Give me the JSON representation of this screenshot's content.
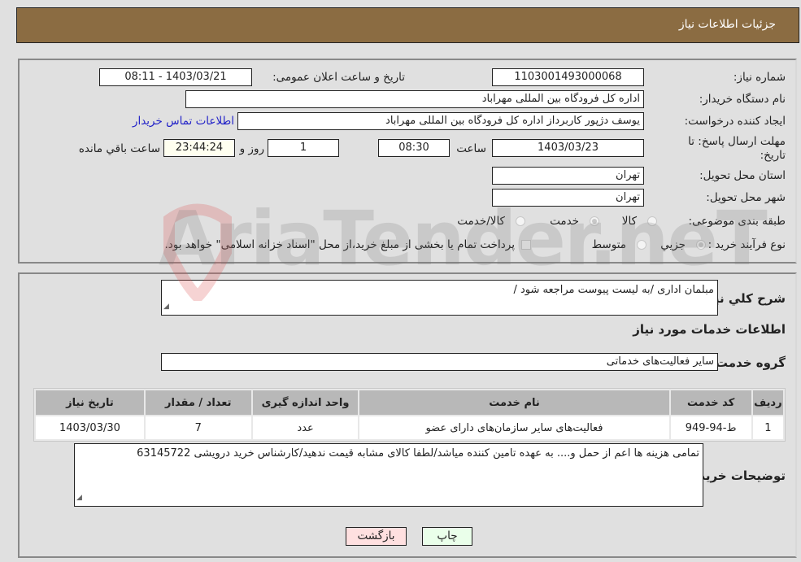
{
  "header": {
    "title": "جزئیات اطلاعات نیاز"
  },
  "form": {
    "need_number_label": "شماره نیاز:",
    "need_number": "1103001493000068",
    "announce_label": "تاریخ و ساعت اعلان عمومی:",
    "announce_value": "1403/03/21 - 08:11",
    "buyer_org_label": "نام دستگاه خریدار:",
    "buyer_org": "اداره کل فرودگاه بین المللی مهراباد",
    "creator_label": "ایجاد کننده درخواست:",
    "creator": "یوسف دژپور کاربرداز اداره کل فرودگاه بین المللی مهراباد",
    "contact_link": "اطلاعات تماس خریدار",
    "deadline_label": "مهلت ارسال پاسخ: تا تاریخ:",
    "deadline_date": "1403/03/23",
    "time_label": "ساعت",
    "deadline_time": "08:30",
    "days_value": "1",
    "days_label": "روز و",
    "remaining_time": "23:44:24",
    "remaining_label": "ساعت باقي مانده",
    "province_label": "استان محل تحویل:",
    "province": "تهران",
    "city_label": "شهر محل تحویل:",
    "city": "تهران",
    "category_label": "طبقه بندی موضوعی:",
    "category_options": [
      "کالا",
      "خدمت",
      "کالا/خدمت"
    ],
    "category_selected": "خدمت",
    "process_label": "نوع فرآیند خرید :",
    "process_options": [
      "جزيي",
      "متوسط"
    ],
    "process_selected": "جزيي",
    "treasury_note": "پرداخت تمام یا بخشی از مبلغ خرید،از محل \"اسناد خزانه اسلامی\" خواهد بود."
  },
  "details": {
    "description_label": "شرح کلي نياز:",
    "description": "مبلمان اداری /به لیست پیوست مراجعه شود /",
    "services_heading": "اطلاعات خدمات مورد نياز",
    "service_group_label": "گروه خدمت:",
    "service_group": "سایر فعالیت‌های خدماتی",
    "table": {
      "headers": [
        "ردیف",
        "کد خدمت",
        "نام خدمت",
        "واحد اندازه گیری",
        "تعداد / مقدار",
        "تاریخ نیاز"
      ],
      "rows": [
        [
          "1",
          "ط-94-949",
          "فعالیت‌های سایر سازمان‌های دارای عضو",
          "عدد",
          "7",
          "1403/03/30"
        ]
      ]
    },
    "buyer_notes_label": "توضيحات خريدار:",
    "buyer_notes": "تمامی هزینه ها اعم از حمل و.... به عهده تامین کننده میاشد/لطفا کالای مشابه قیمت ندهید/کارشناس خرید درویشی 63145722"
  },
  "buttons": {
    "print": "چاپ",
    "back": "بازگشت"
  },
  "watermark": "AriaTender.neT"
}
